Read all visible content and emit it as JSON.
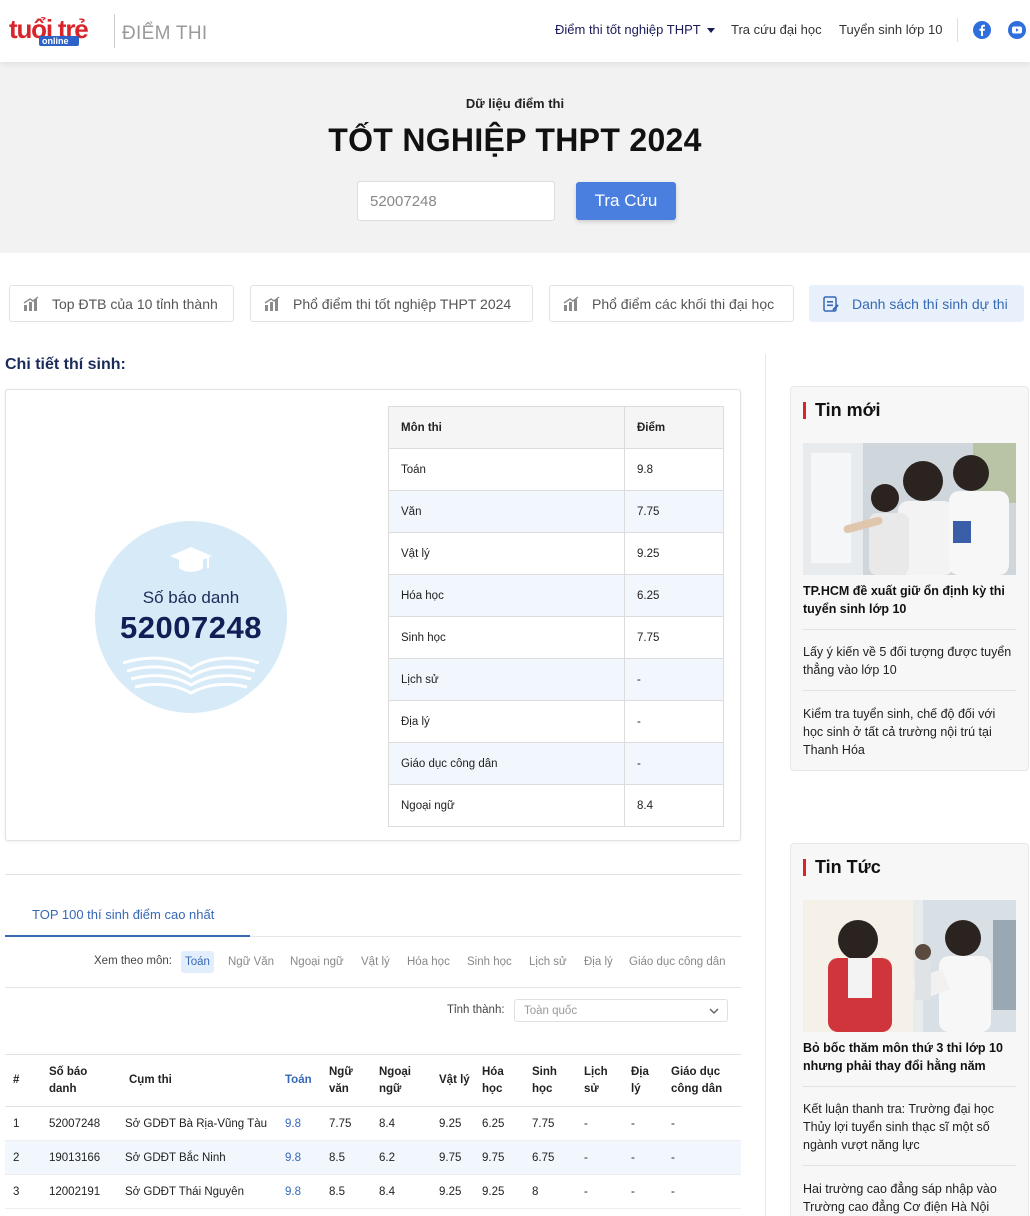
{
  "header": {
    "logo_text": "tuổi trẻ",
    "logo_sub": "online",
    "section_title": "ĐIỂM THI",
    "nav": [
      {
        "label": "Điểm thi tốt nghiệp THPT"
      },
      {
        "label": "Tra cứu đại học"
      },
      {
        "label": "Tuyển sinh lớp 10"
      }
    ],
    "social": [
      "facebook-icon",
      "youtube-icon"
    ]
  },
  "hero": {
    "subtitle": "Dữ liệu điểm thi",
    "title": "TỐT NGHIỆP THPT 2024",
    "search_value": "52007248",
    "search_button": "Tra Cứu"
  },
  "tabs": [
    {
      "label": "Top ĐTB của 10 tỉnh thành",
      "icon": "bar-chart-icon"
    },
    {
      "label": "Phổ điểm thi tốt nghiệp THPT 2024",
      "icon": "bar-chart-icon"
    },
    {
      "label": "Phổ điểm các khối thi đại học",
      "icon": "bar-chart-icon"
    },
    {
      "label": "Danh sách thí sinh dự thi",
      "icon": "list-icon"
    }
  ],
  "detail": {
    "title": "Chi tiết thí sinh:",
    "sbd_label": "Số báo danh",
    "sbd": "52007248",
    "table_headers": [
      "Môn thi",
      "Điểm"
    ],
    "scores": [
      {
        "subject": "Toán",
        "score": "9.8"
      },
      {
        "subject": "Văn",
        "score": "7.75"
      },
      {
        "subject": "Vật lý",
        "score": "9.25"
      },
      {
        "subject": "Hóa học",
        "score": "6.25"
      },
      {
        "subject": "Sinh học",
        "score": "7.75"
      },
      {
        "subject": "Lịch sử",
        "score": "-"
      },
      {
        "subject": "Địa lý",
        "score": "-"
      },
      {
        "subject": "Giáo dục công dân",
        "score": "-"
      },
      {
        "subject": "Ngoại ngữ",
        "score": "8.4"
      }
    ]
  },
  "top100": {
    "tab_label": "TOP 100 thí sinh điểm cao nhất",
    "filter_label": "Xem theo môn:",
    "filters": [
      "Toán",
      "Ngữ Văn",
      "Ngoại ngữ",
      "Vật lý",
      "Hóa học",
      "Sinh học",
      "Lịch sử",
      "Địa lý",
      "Giáo dục công dân"
    ],
    "active_filter": "Toán",
    "province_label": "Tỉnh thành:",
    "province_value": "Toàn quốc",
    "columns": [
      "#",
      "Số báo danh",
      "Cụm thi",
      "Toán",
      "Ngữ văn",
      "Ngoại ngữ",
      "Vật lý",
      "Hóa học",
      "Sinh học",
      "Lịch sử",
      "Địa lý",
      "Giáo dục công dân"
    ],
    "rows": [
      [
        "1",
        "52007248",
        "Sở GDĐT Bà Rịa-Vũng Tàu",
        "9.8",
        "7.75",
        "8.4",
        "9.25",
        "6.25",
        "7.75",
        "-",
        "-",
        "-"
      ],
      [
        "2",
        "19013166",
        "Sở GDĐT Bắc Ninh",
        "9.8",
        "8.5",
        "6.2",
        "9.75",
        "9.75",
        "6.75",
        "-",
        "-",
        "-"
      ],
      [
        "3",
        "12002191",
        "Sở GDĐT Thái Nguyên",
        "9.8",
        "8.5",
        "8.4",
        "9.25",
        "9.25",
        "8",
        "-",
        "-",
        "-"
      ]
    ]
  },
  "sidebar": {
    "box1": {
      "title": "Tin mới",
      "lead": "TP.HCM đề xuất giữ ổn định kỳ thi tuyển sinh lớp 10",
      "items": [
        "Lấy ý kiến về 5 đối tượng được tuyển thẳng vào lớp 10",
        "Kiểm tra tuyển sinh, chế độ đối với học sinh ở tất cả trường nội trú tại Thanh Hóa"
      ]
    },
    "box2": {
      "title": "Tin Tức",
      "lead": "Bỏ bốc thăm môn thứ 3 thi lớp 10 nhưng phải thay đổi hằng năm",
      "items": [
        "Kết luận thanh tra: Trường đại học Thủy lợi tuyển sinh thạc sĩ một số ngành vượt năng lực",
        "Hai trường cao đẳng sáp nhập vào Trường cao đẳng Cơ điện Hà Nội"
      ]
    }
  },
  "colors": {
    "brand_red": "#d8242b",
    "accent_blue": "#4a7fe0",
    "navy": "#1a2c5a"
  }
}
